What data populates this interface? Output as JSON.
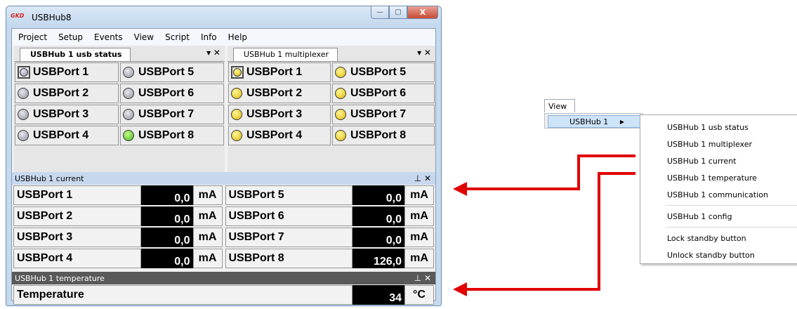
{
  "window": {
    "logo": "GKD",
    "title": "USBHub8",
    "buttons": {
      "minimize": "—",
      "maximize": "▢",
      "close": "X"
    }
  },
  "menubar": [
    "Project",
    "Setup",
    "Events",
    "View",
    "Script",
    "Info",
    "Help"
  ],
  "usb_status": {
    "tab": "USBHub 1 usb status",
    "controls": "▾ ✕",
    "rows": [
      [
        {
          "label": "USBPort 1",
          "led": "grey"
        },
        {
          "label": "USBPort 5",
          "led": "grey"
        }
      ],
      [
        {
          "label": "USBPort 2",
          "led": "grey"
        },
        {
          "label": "USBPort 6",
          "led": "grey"
        }
      ],
      [
        {
          "label": "USBPort 3",
          "led": "grey"
        },
        {
          "label": "USBPort 7",
          "led": "grey"
        }
      ],
      [
        {
          "label": "USBPort 4",
          "led": "grey"
        },
        {
          "label": "USBPort 8",
          "led": "green"
        }
      ]
    ]
  },
  "multiplexer": {
    "tab": "USBHub 1 multiplexer",
    "controls": "▾ ✕",
    "rows": [
      [
        {
          "label": "USBPort 1",
          "led": "yellow"
        },
        {
          "label": "USBPort 5",
          "led": "yellow"
        }
      ],
      [
        {
          "label": "USBPort 2",
          "led": "yellow"
        },
        {
          "label": "USBPort 6",
          "led": "yellow"
        }
      ],
      [
        {
          "label": "USBPort 3",
          "led": "yellow"
        },
        {
          "label": "USBPort 7",
          "led": "yellow"
        }
      ],
      [
        {
          "label": "USBPort 4",
          "led": "yellow"
        },
        {
          "label": "USBPort 8",
          "led": "yellow"
        }
      ]
    ]
  },
  "current": {
    "title": "USBHub 1 current",
    "controls": "⊥ ✕",
    "rows": [
      [
        {
          "label": "USBPort 1",
          "value": "0,0",
          "unit": "mA"
        },
        {
          "label": "USBPort 5",
          "value": "0,0",
          "unit": "mA"
        }
      ],
      [
        {
          "label": "USBPort 2",
          "value": "0,0",
          "unit": "mA"
        },
        {
          "label": "USBPort 6",
          "value": "0,0",
          "unit": "mA"
        }
      ],
      [
        {
          "label": "USBPort 3",
          "value": "0,0",
          "unit": "mA"
        },
        {
          "label": "USBPort 7",
          "value": "0,0",
          "unit": "mA"
        }
      ],
      [
        {
          "label": "USBPort 4",
          "value": "0,0",
          "unit": "mA"
        },
        {
          "label": "USBPort 8",
          "value": "126,0",
          "unit": "mA"
        }
      ]
    ]
  },
  "temperature": {
    "title": "USBHub 1 temperature",
    "controls": "⊥ ✕",
    "label": "Temperature",
    "value": "34",
    "unit": "°C"
  },
  "view_menu": {
    "top": "View",
    "submenu": "USBHub 1",
    "submenu_arrow": "▶",
    "items_a": [
      "USBHub 1 usb status",
      "USBHub 1 multiplexer",
      "USBHub 1 current",
      "USBHub 1 temperature",
      "USBHub 1 communication"
    ],
    "items_b": [
      "USBHub 1 config"
    ],
    "items_c": [
      "Lock standby button",
      "Unlock standby button"
    ]
  },
  "colors": {
    "arrow": "#e00000",
    "led_grey": "#9a9ca5",
    "led_green": "#5ccb1e",
    "led_yellow": "#f2cc00"
  }
}
